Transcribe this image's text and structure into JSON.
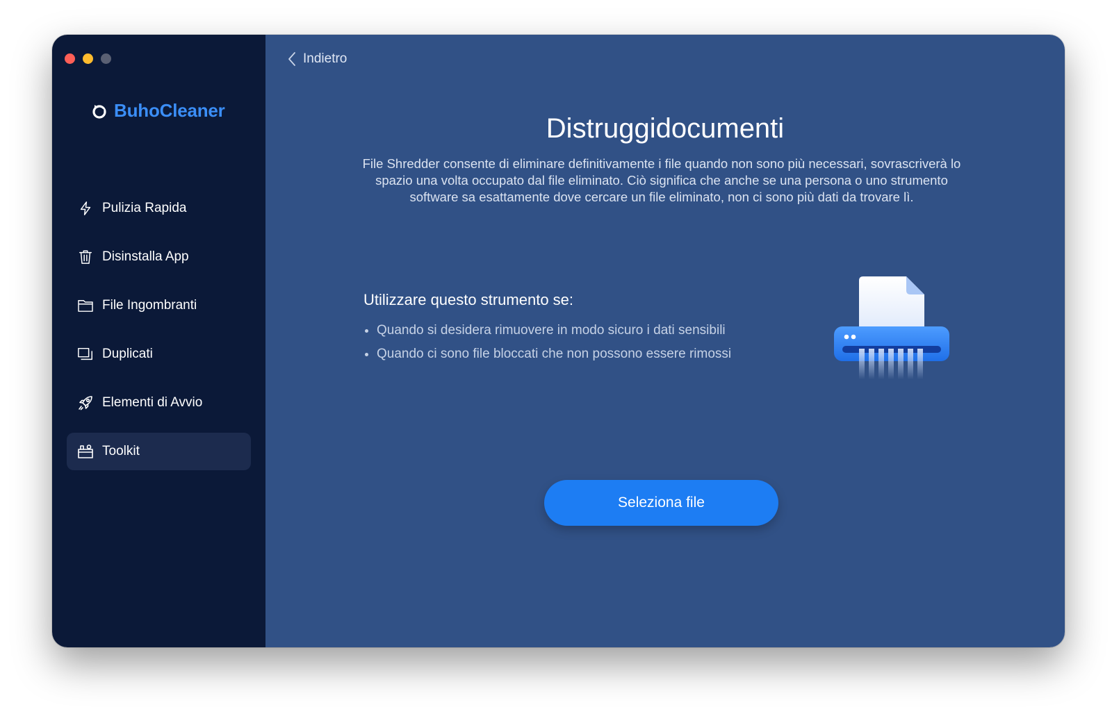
{
  "window": {
    "controls": [
      "close",
      "minimize",
      "zoom"
    ]
  },
  "brand": {
    "name": "BuhoCleaner",
    "accent_color": "#3b8ef7"
  },
  "sidebar": {
    "items": [
      {
        "label": "Pulizia Rapida",
        "icon": "lightning-icon",
        "active": false
      },
      {
        "label": "Disinstalla App",
        "icon": "trash-icon",
        "active": false
      },
      {
        "label": "File Ingombranti",
        "icon": "folder-icon",
        "active": false
      },
      {
        "label": "Duplicati",
        "icon": "duplicate-icon",
        "active": false
      },
      {
        "label": "Elementi di Avvio",
        "icon": "rocket-icon",
        "active": false
      },
      {
        "label": "Toolkit",
        "icon": "toolkit-icon",
        "active": true
      }
    ]
  },
  "main": {
    "back_label": "Indietro",
    "title": "Distruggidocumenti",
    "description": "File Shredder consente di eliminare definitivamente i file quando non sono più necessari, sovrascriverà lo spazio una volta occupato dal file eliminato. Ciò significa che anche se una persona o uno strumento software sa esattamente dove cercare un file eliminato, non ci sono più dati da trovare lì.",
    "usage_heading": "Utilizzare questo strumento se:",
    "usage_items": [
      "Quando si desidera rimuovere in modo sicuro i dati sensibili",
      "Quando ci sono file bloccati che non possono essere rimossi"
    ],
    "illustration": "shredder-icon",
    "select_button_label": "Seleziona file"
  },
  "colors": {
    "sidebar_bg": "#0b1938",
    "main_bg": "#315186",
    "button": "#1d7df3"
  }
}
